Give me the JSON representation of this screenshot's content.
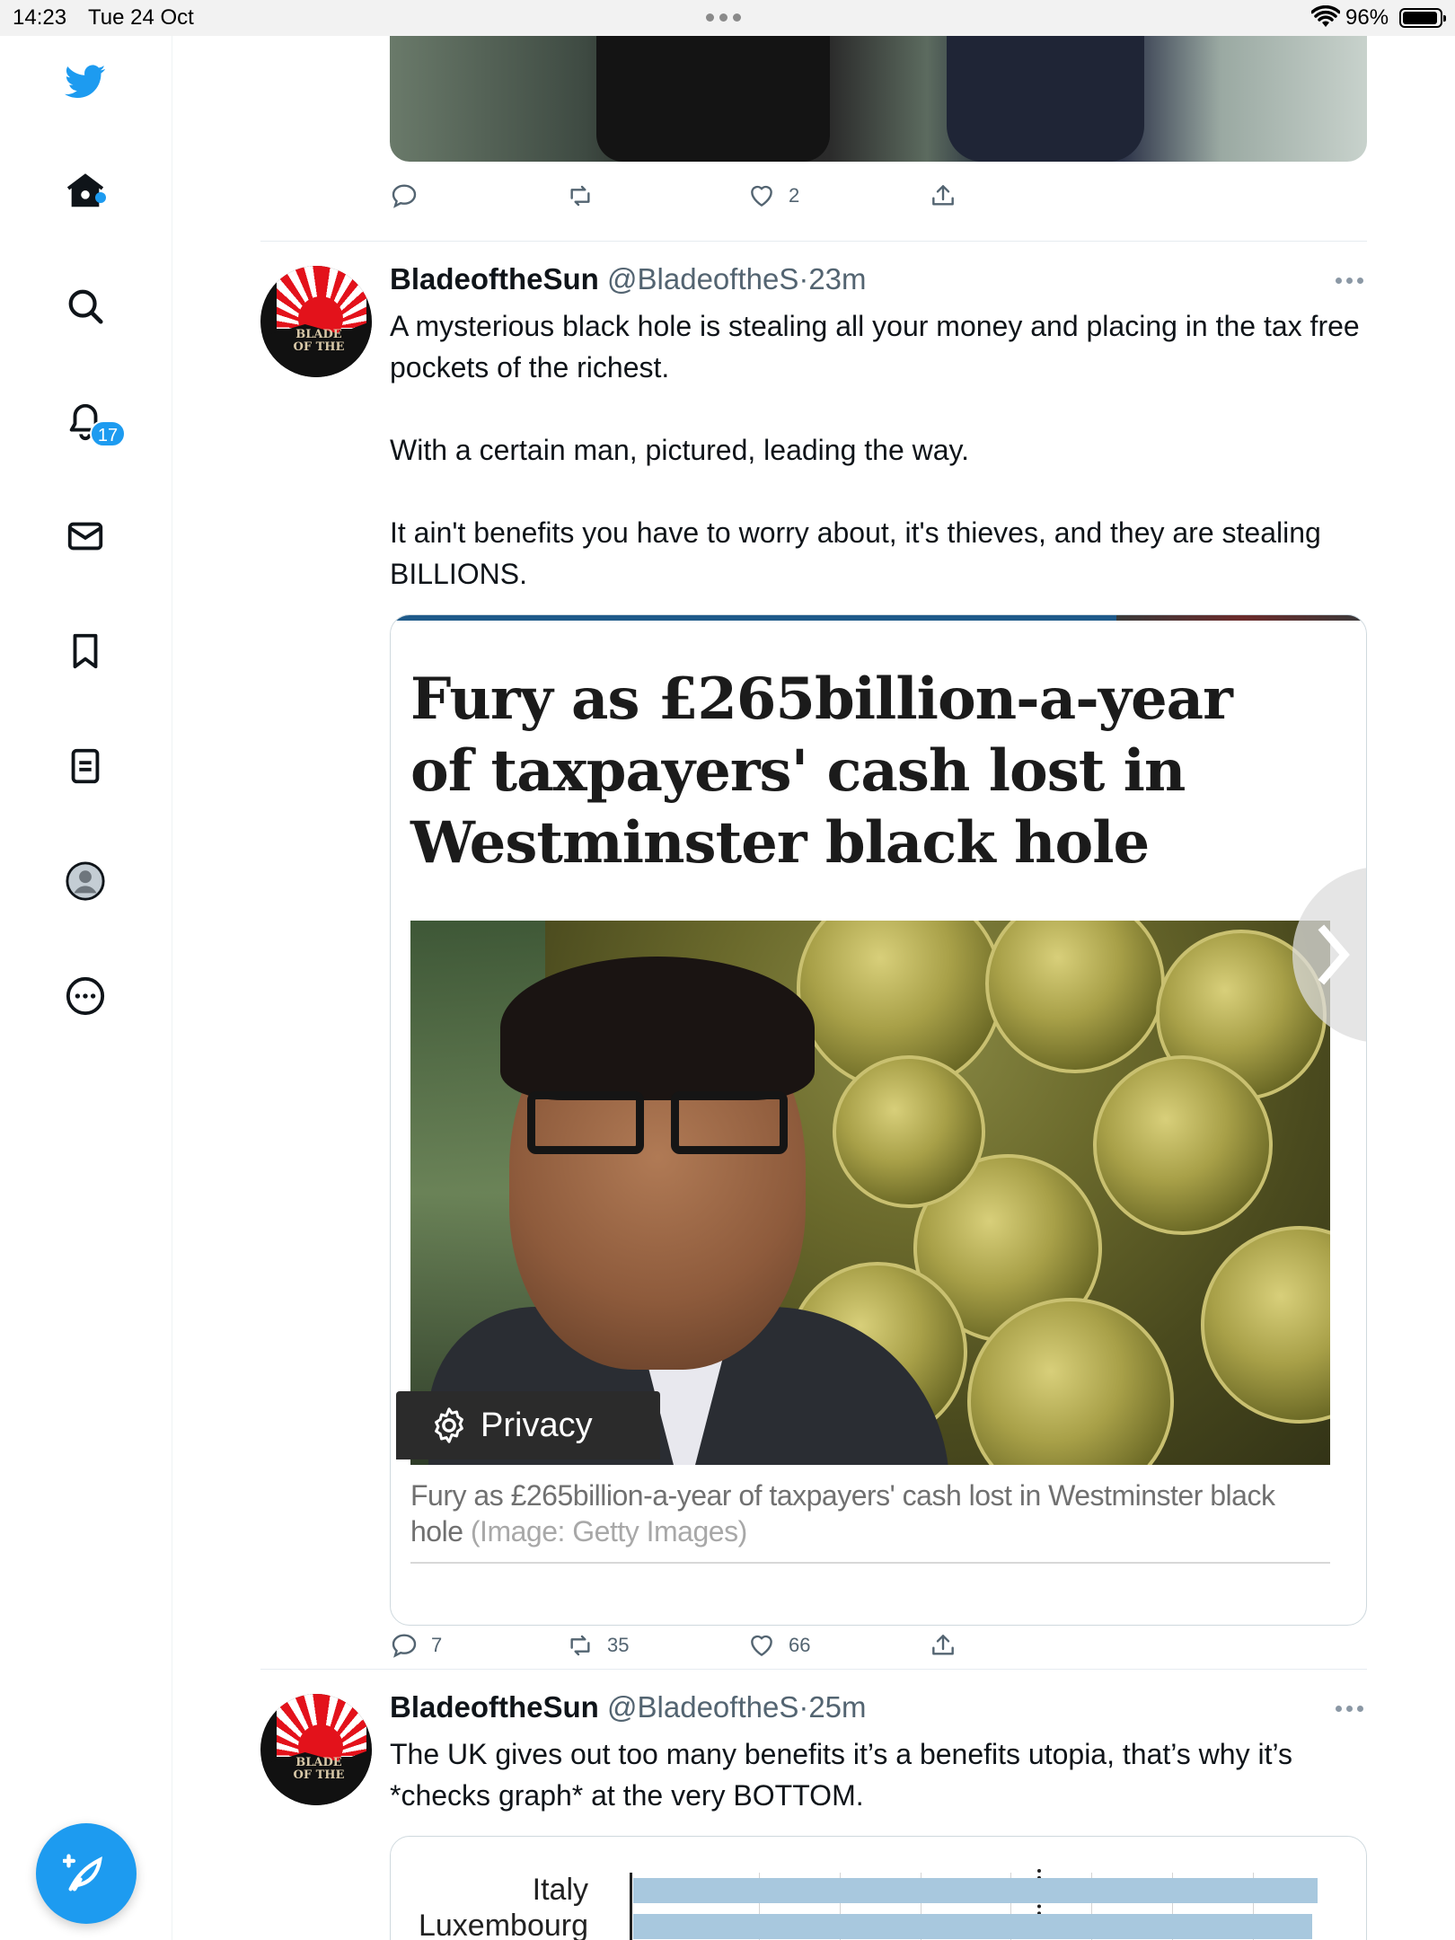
{
  "status_bar": {
    "time": "14:23",
    "date": "Tue 24 Oct",
    "battery": "96%"
  },
  "sidebar": {
    "items": [
      {
        "icon": "twitter-logo-icon"
      },
      {
        "icon": "home-icon"
      },
      {
        "icon": "search-icon"
      },
      {
        "icon": "notifications-bell-icon",
        "badge": "17"
      },
      {
        "icon": "messages-envelope-icon"
      },
      {
        "icon": "bookmark-icon"
      },
      {
        "icon": "lists-icon"
      },
      {
        "icon": "profile-avatar-icon"
      },
      {
        "icon": "more-circle-icon"
      }
    ],
    "compose_icon": "compose-feather-icon",
    "accent_color": "#1d9bf0"
  },
  "tweets": [
    {
      "actions": {
        "reply": "",
        "retweet": "",
        "like": "2"
      }
    },
    {
      "name": "BladeoftheSun",
      "handle": "@BladeoftheS",
      "separator": "·",
      "time": "23m",
      "text": [
        "A mysterious black hole is stealing all your money and placing in the tax free pockets of the richest.",
        "With a certain man, pictured, leading the way.",
        "It ain't benefits you have to worry about, it's thieves, and they are stealing BILLIONS."
      ],
      "card": {
        "headline": "Fury as £265billion-a-year of taxpayers' cash lost in Westminster black hole",
        "privacy_label": "Privacy",
        "caption": "Fury as £265billion-a-year of taxpayers' cash lost in Westminster black hole",
        "caption_credit": "(Image: Getty Images)"
      },
      "actions": {
        "reply": "7",
        "retweet": "35",
        "like": "66"
      }
    },
    {
      "name": "BladeoftheSun",
      "handle": "@BladeoftheS",
      "separator": "·",
      "time": "25m",
      "text": [
        "The UK gives out too many benefits it’s a benefits utopia, that’s why it’s *checks graph* at the very BOTTOM."
      ],
      "chart": {
        "labels": [
          "Italy",
          "Luxembourg"
        ]
      }
    }
  ]
}
